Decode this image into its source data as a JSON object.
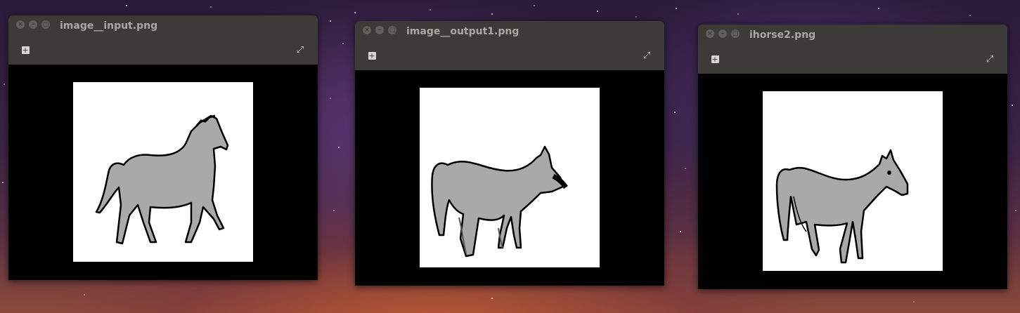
{
  "windows": [
    {
      "title": "image__input.png",
      "add_icon": "plus-box-icon",
      "fullscreen_icon": "fullscreen-icon"
    },
    {
      "title": "image__output1.png",
      "add_icon": "plus-box-icon",
      "fullscreen_icon": "fullscreen-icon"
    },
    {
      "title": "ihorse2.png",
      "add_icon": "plus-box-icon",
      "fullscreen_icon": "fullscreen-icon"
    }
  ],
  "controls": {
    "close": "×",
    "minimize": "–",
    "maximize": "□",
    "add": "+",
    "fullscreen": "⤢"
  },
  "colors": {
    "titlebar": "#3c3b37",
    "horse_fill": "#a9a9a9",
    "title_text": "#aaa8a2"
  }
}
